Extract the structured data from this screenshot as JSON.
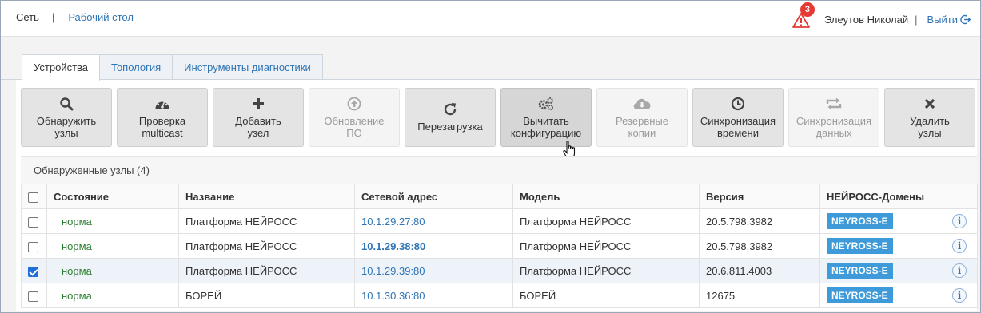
{
  "header": {
    "network": "Сеть",
    "separator": "|",
    "desktop_link": "Рабочий стол",
    "alerts_count": "3",
    "user_name": "Элеутов Николай",
    "user_separator": "|",
    "logout": "Выйти"
  },
  "tabs": [
    {
      "label": "Устройства",
      "active": true
    },
    {
      "label": "Топология",
      "active": false
    },
    {
      "label": "Инструменты диагностики",
      "active": false
    }
  ],
  "toolbar": [
    {
      "line1": "Обнаружить",
      "line2": "узлы",
      "icon": "search-icon",
      "state": "normal"
    },
    {
      "line1": "Проверка",
      "line2": "multicast",
      "icon": "gauge-icon",
      "state": "normal"
    },
    {
      "line1": "Добавить",
      "line2": "узел",
      "icon": "plus-icon",
      "state": "normal"
    },
    {
      "line1": "Обновление",
      "line2": "ПО",
      "icon": "upload-circle-icon",
      "state": "disabled"
    },
    {
      "line1": "Перезагрузка",
      "line2": "",
      "icon": "refresh-icon",
      "state": "normal"
    },
    {
      "line1": "Вычитать",
      "line2": "конфигурацию",
      "icon": "gears-icon",
      "state": "hover"
    },
    {
      "line1": "Резервные",
      "line2": "копии",
      "icon": "cloud-download-icon",
      "state": "disabled"
    },
    {
      "line1": "Синхронизация",
      "line2": "времени",
      "icon": "clock-icon",
      "state": "normal"
    },
    {
      "line1": "Синхронизация",
      "line2": "данных",
      "icon": "sync-icon",
      "state": "disabled"
    },
    {
      "line1": "Удалить",
      "line2": "узлы",
      "icon": "close-icon",
      "state": "normal"
    }
  ],
  "table": {
    "title": "Обнаруженные узлы (4)",
    "columns": [
      "Состояние",
      "Название",
      "Сетевой адрес",
      "Модель",
      "Версия",
      "НЕЙРОСС-Домены"
    ],
    "rows": [
      {
        "checked": false,
        "state": "норма",
        "name": "Платформа НЕЙРОСС",
        "address": "10.1.29.27:80",
        "address_bold": false,
        "model": "Платформа НЕЙРОСС",
        "version": "20.5.798.3982",
        "domain": "NEYROSS-E"
      },
      {
        "checked": false,
        "state": "норма",
        "name": "Платформа НЕЙРОСС",
        "address": "10.1.29.38:80",
        "address_bold": true,
        "model": "Платформа НЕЙРОСС",
        "version": "20.5.798.3982",
        "domain": "NEYROSS-E"
      },
      {
        "checked": true,
        "state": "норма",
        "name": "Платформа НЕЙРОСС",
        "address": "10.1.29.39:80",
        "address_bold": false,
        "model": "Платформа НЕЙРОСС",
        "version": "20.6.811.4003",
        "domain": "NEYROSS-E"
      },
      {
        "checked": false,
        "state": "норма",
        "name": "БОРЕЙ",
        "address": "10.1.30.36:80",
        "address_bold": false,
        "model": "БОРЕЙ",
        "version": "12675",
        "domain": "NEYROSS-E"
      }
    ]
  },
  "colors": {
    "link": "#2e74b5",
    "status_ok": "#2e7d32",
    "badge": "#3e9ad8",
    "alert": "#e53935"
  }
}
